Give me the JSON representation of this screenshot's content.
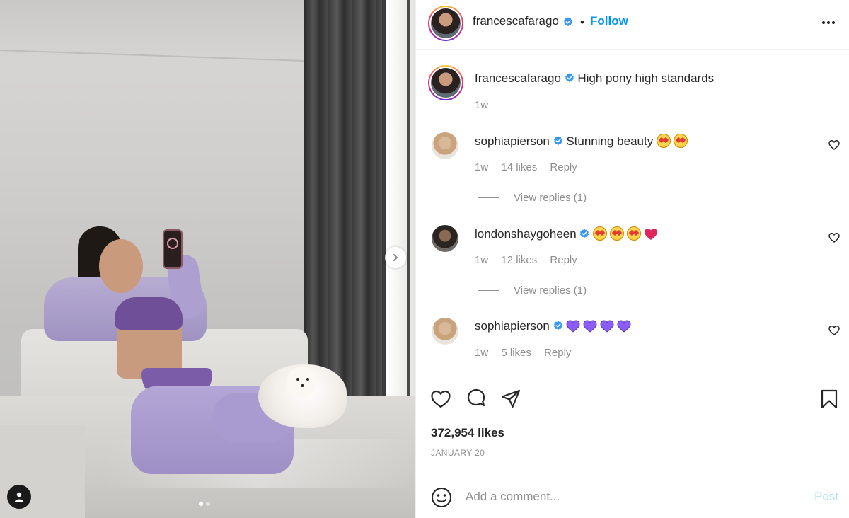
{
  "post": {
    "author": "francescafarago",
    "follow_separator": "•",
    "follow_label": "Follow",
    "caption_author": "francescafarago",
    "caption_text": "High pony high standards",
    "caption_time": "1w",
    "likes": "372,954 likes",
    "date": "JANUARY 20",
    "carousel": {
      "count": 2,
      "active": 1
    }
  },
  "comments": [
    {
      "user": "sophiapierson",
      "text": "Stunning beauty",
      "emojis": [
        "star-struck-emoji",
        "star-struck-emoji"
      ],
      "time": "1w",
      "likes": "14 likes",
      "reply": "Reply",
      "view_replies": "View replies (1)"
    },
    {
      "user": "londonshaygoheen",
      "text": "",
      "emojis": [
        "star-struck-emoji",
        "star-struck-emoji",
        "star-struck-emoji",
        "red-heart-emoji"
      ],
      "time": "1w",
      "likes": "12 likes",
      "reply": "Reply",
      "view_replies": "View replies (1)"
    },
    {
      "user": "sophiapierson",
      "text": "",
      "emojis": [
        "purple-heart-emoji",
        "purple-heart-emoji",
        "purple-heart-emoji",
        "purple-heart-emoji"
      ],
      "time": "1w",
      "likes": "5 likes",
      "reply": "Reply"
    }
  ],
  "add_comment": {
    "placeholder": "Add a comment...",
    "post_label": "Post"
  },
  "icons": [
    "more-options-icon",
    "verified-badge-icon",
    "heart-icon",
    "comment-icon",
    "share-icon",
    "bookmark-icon",
    "smile-icon",
    "user-tag-icon",
    "chevron-right-icon"
  ],
  "colors": {
    "link_blue": "#0095f6",
    "post_disabled": "#b2dffc",
    "verified_blue": "#3897f0",
    "muted": "#8e8e8e",
    "purple_heart": "#8b5cf6",
    "red_heart": "#e0245e"
  }
}
